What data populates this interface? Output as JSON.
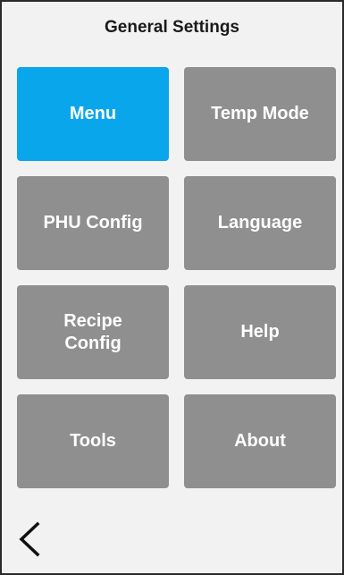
{
  "header": {
    "title": "General Settings"
  },
  "tiles": [
    {
      "label": "Menu",
      "active": true
    },
    {
      "label": "Temp Mode",
      "active": false
    },
    {
      "label": "PHU Config",
      "active": false
    },
    {
      "label": "Language",
      "active": false
    },
    {
      "label": "Recipe\nConfig",
      "active": false
    },
    {
      "label": "Help",
      "active": false
    },
    {
      "label": "Tools",
      "active": false
    },
    {
      "label": "About",
      "active": false
    }
  ],
  "footer": {
    "back_icon": "chevron-left-icon"
  },
  "colors": {
    "active_tile": "#0aa6ec",
    "tile": "#8f8f8f",
    "background": "#f2f2f2"
  }
}
